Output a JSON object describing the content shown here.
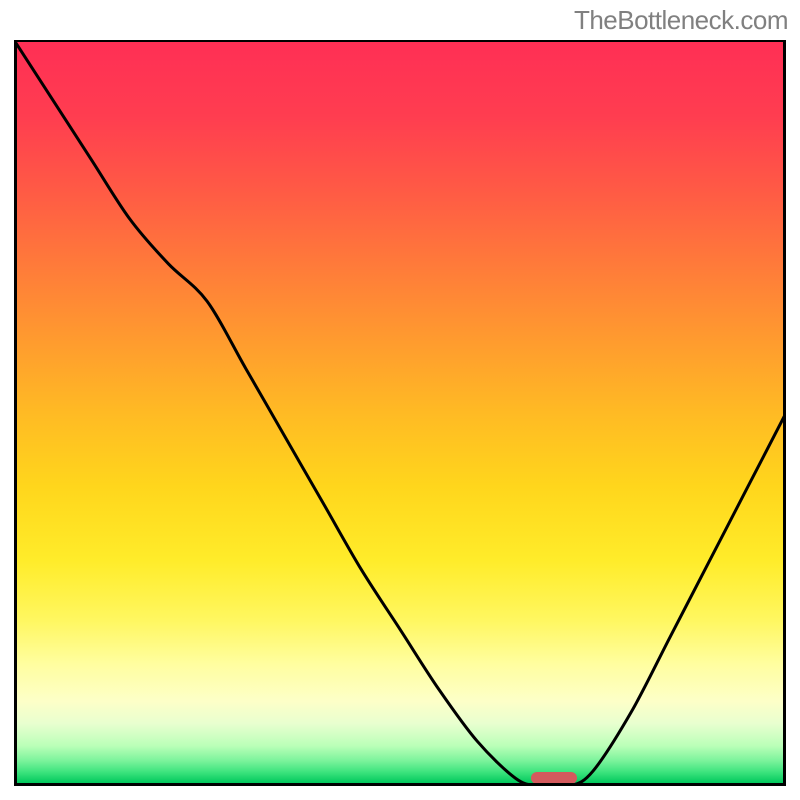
{
  "watermark": "TheBottleneck.com",
  "chart_data": {
    "type": "line",
    "title": "",
    "xlabel": "",
    "ylabel": "",
    "x": [
      0.0,
      0.05,
      0.1,
      0.15,
      0.2,
      0.25,
      0.3,
      0.35,
      0.4,
      0.45,
      0.5,
      0.55,
      0.6,
      0.65,
      0.68,
      0.72,
      0.75,
      0.8,
      0.85,
      0.9,
      0.95,
      1.0
    ],
    "values": [
      1.0,
      0.92,
      0.84,
      0.76,
      0.7,
      0.65,
      0.56,
      0.47,
      0.38,
      0.29,
      0.21,
      0.13,
      0.06,
      0.01,
      0.0,
      0.0,
      0.02,
      0.1,
      0.2,
      0.3,
      0.4,
      0.5
    ],
    "ylim": [
      0,
      1
    ],
    "xlim": [
      0,
      1
    ],
    "grid": false,
    "legend": false,
    "valley_x": 0.7,
    "annotations": [
      {
        "type": "marker",
        "shape": "rounded-bar",
        "color": "#d45a5d",
        "x": 0.7,
        "y": 0.0
      }
    ],
    "background": "vertical-gradient red→orange→yellow→green"
  },
  "colors": {
    "curve": "#000000",
    "border": "#000000",
    "marker": "#d45a5d",
    "watermark": "#808080"
  }
}
